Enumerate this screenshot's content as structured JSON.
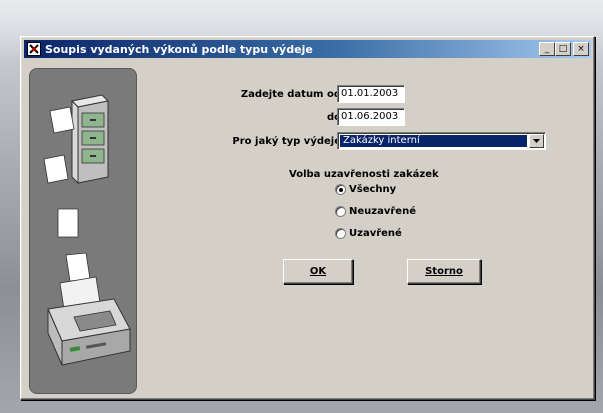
{
  "window": {
    "title": "Soupis vydaných výkonů podle typu výdeje",
    "minimize_glyph": "_",
    "maximize_glyph": "□",
    "close_glyph": "×"
  },
  "form": {
    "date_from_label": "Zadejte datum od",
    "date_from_value": "01.01.2003",
    "date_to_label": "do",
    "date_to_value": "01.06.2003",
    "type_label": "Pro jaký typ výdeje",
    "type_value": "Zakázky interní"
  },
  "completion": {
    "group_title": "Volba uzavřenosti zakázek",
    "options": [
      {
        "label": "Všechny",
        "selected": true
      },
      {
        "label": "Neuzavřené",
        "selected": false
      },
      {
        "label": "Uzavřené",
        "selected": false
      }
    ]
  },
  "buttons": {
    "ok_label": "OK",
    "cancel_label": "Storno"
  },
  "colors": {
    "titlebar_start": "#0a246a",
    "titlebar_end": "#a6caf0",
    "window_bg": "#d4d0c8",
    "selection_bg": "#0a246a"
  }
}
